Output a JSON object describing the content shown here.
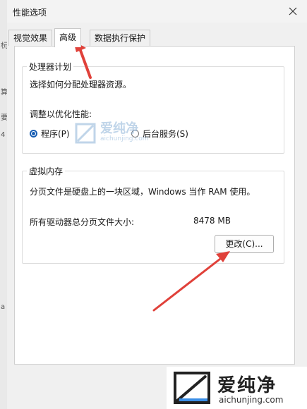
{
  "background": {
    "edge_labels": [
      "杬",
      "算",
      "要",
      "4",
      "a"
    ]
  },
  "window": {
    "title": "性能选项",
    "close_label": "×"
  },
  "tabs": [
    {
      "label": "视觉效果"
    },
    {
      "label": "高级"
    },
    {
      "label": "数据执行保护"
    }
  ],
  "processor": {
    "legend": "处理器计划",
    "description": "选择如何分配处理器资源。",
    "adjust_label": "调整以优化性能:",
    "options": [
      {
        "label": "程序(P)",
        "selected": true
      },
      {
        "label": "后台服务(S)",
        "selected": false
      }
    ]
  },
  "virtual_memory": {
    "legend": "虚拟内存",
    "description": "分页文件是硬盘上的一块区域，Windows 当作 RAM 使用。",
    "total_label": "所有驱动器总分页文件大小:",
    "total_value": "8478 MB",
    "change_button": "更改(C)..."
  },
  "watermark": {
    "name": "爱纯净",
    "url": "aichunjing.com"
  },
  "colors": {
    "accent": "#1a5fb4",
    "arrow": "#e0413a"
  }
}
